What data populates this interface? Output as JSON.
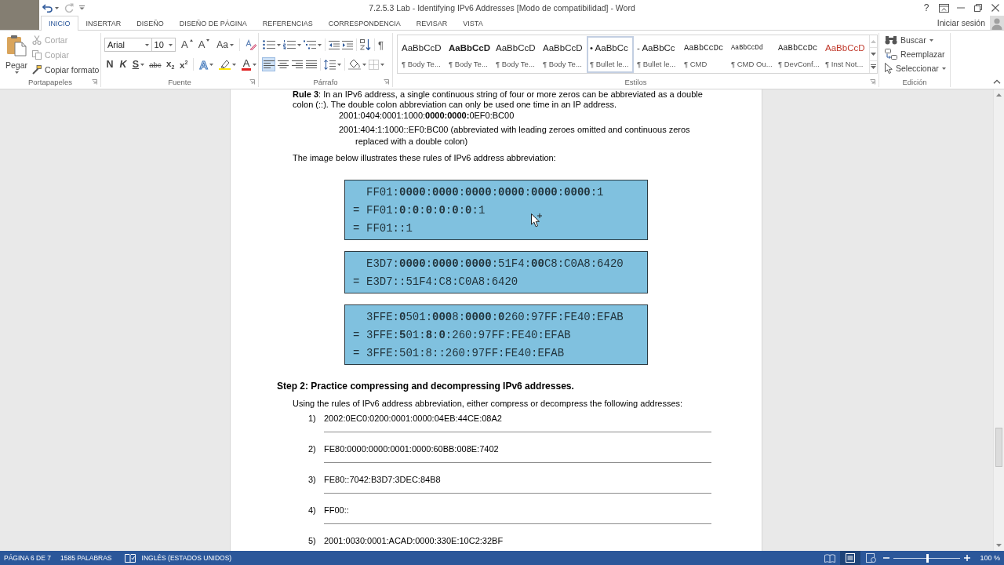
{
  "title_bar": {
    "title": "7.2.5.3 Lab - Identifying IPv6 Addresses [Modo de compatibilidad] - Word",
    "help": "?"
  },
  "tabs": [
    {
      "label": "INICIO",
      "selected": true
    },
    {
      "label": "INSERTAR",
      "selected": false
    },
    {
      "label": "DISEÑO",
      "selected": false
    },
    {
      "label": "DISEÑO DE PÁGINA",
      "selected": false
    },
    {
      "label": "REFERENCIAS",
      "selected": false
    },
    {
      "label": "CORRESPONDENCIA",
      "selected": false
    },
    {
      "label": "REVISAR",
      "selected": false
    },
    {
      "label": "VISTA",
      "selected": false
    }
  ],
  "account": {
    "label": "Iniciar sesión"
  },
  "ribbon": {
    "clipboard": {
      "label": "Portapapeles",
      "paste": "Pegar",
      "actions": [
        {
          "kind": "cut",
          "label": "Cortar",
          "disabled": true
        },
        {
          "kind": "copy",
          "label": "Copiar",
          "disabled": true
        },
        {
          "kind": "format",
          "label": "Copiar formato",
          "disabled": false
        }
      ]
    },
    "font": {
      "label": "Fuente",
      "font_name": "Arial",
      "font_size": "10",
      "size_buttons": [
        {
          "kind": "grow",
          "label": "A"
        },
        {
          "kind": "shrink",
          "label": "A"
        }
      ],
      "case_label": "Aa",
      "format_buttons": [
        {
          "kind": "bold",
          "label": "N",
          "menu": false
        },
        {
          "kind": "italic",
          "label": "K",
          "menu": false
        },
        {
          "kind": "underline",
          "label": "S",
          "menu": true
        },
        {
          "kind": "strike",
          "label": "abc",
          "menu": false
        },
        {
          "kind": "sub",
          "label": "x$_{2}$",
          "menu": false
        },
        {
          "kind": "sup",
          "label": "x$^{2}$",
          "menu": false
        }
      ],
      "effects_label": "A",
      "color_label": "A"
    },
    "paragraph": {
      "label": "Párrafo",
      "marks": "¶",
      "alignments": [
        {
          "kind": "left",
          "selected": true
        },
        {
          "kind": "center",
          "selected": false
        },
        {
          "kind": "right",
          "selected": false
        },
        {
          "kind": "justify",
          "selected": false
        }
      ]
    },
    "styles": {
      "label": "Estilos",
      "items": [
        {
          "preview": "AaBbCcD",
          "name": "¶ Body Te...",
          "kind": "plain",
          "selected": false
        },
        {
          "preview": "AaBbCcD",
          "name": "¶ Body Te...",
          "kind": "strong",
          "selected": false
        },
        {
          "preview": "AaBbCcD",
          "name": "¶ Body Te...",
          "kind": "plain",
          "selected": false
        },
        {
          "preview": "AaBbCcD",
          "name": "¶ Body Te...",
          "kind": "plain",
          "selected": false
        },
        {
          "preview": "• AaBbCc",
          "name": "¶ Bullet le...",
          "kind": "plain",
          "selected": true
        },
        {
          "preview": "- AaBbCc",
          "name": "¶ Bullet le...",
          "kind": "plain",
          "selected": false
        },
        {
          "preview": "AaBbCcDc",
          "name": "¶ CMD",
          "kind": "code",
          "selected": false
        },
        {
          "preview": "AaBbCcDd",
          "name": "¶ CMD Ou...",
          "kind": "output",
          "selected": false
        },
        {
          "preview": "AaBbCcDc",
          "name": "¶ DevConf...",
          "kind": "code",
          "selected": false
        },
        {
          "preview": "AaBbCcD",
          "name": "¶ Inst Not...",
          "kind": "note",
          "selected": false
        }
      ]
    },
    "editing": {
      "label": "Edición",
      "actions": [
        {
          "kind": "find",
          "label": "Buscar",
          "menu": true
        },
        {
          "kind": "replace",
          "label": "Reemplazar",
          "menu": false
        },
        {
          "kind": "select",
          "label": "Seleccionar",
          "menu": true
        }
      ]
    }
  },
  "document": {
    "rule": "**Rule 3**: In an IPv6 address, a single continuous string of four or more zeros can be abbreviated as a double colon (::). The double colon abbreviation can only be used one time in an IP address.",
    "examples": [
      "2001:0404:0001:1000:**0000:0000:**0EF0:BC00",
      "2001:404:1:1000::EF0:BC00 (abbreviated with leading zeroes omitted and continuous zeros replaced with a double colon)"
    ],
    "intro": "The image below illustrates these rules of IPv6 address abbreviation:",
    "figure": [
      {
        "lines": [
          {
            "text": "FF01:**0000**:**0000**:**0000**:**0000**:**0000**:**0000**:1"
          },
          {
            "lead": "=",
            "text": "FF01:**0**:**0**:**0**:**0**:**0**:**0**:1"
          },
          {
            "lead": "=",
            "text": "FF01::1"
          }
        ]
      },
      {
        "lines": [
          {
            "text": "E3D7:**0000**:**0000**:**0000**:51F4:**00**C8:C0A8:6420"
          },
          {
            "lead": "=",
            "text": "E3D7::51F4:C8:C0A8:6420"
          }
        ]
      },
      {
        "lines": [
          {
            "text": "3FFE:**0**501:**000**8:**0000**:**0**260:97FF:FE40:EFAB"
          },
          {
            "lead": "=",
            "text": "3FFE:**5**01:**8**:**0**:260:97FF:FE40:EFAB"
          },
          {
            "lead": "=",
            "text": "3FFE:501:8::260:97FF:FE40:EFAB"
          }
        ]
      }
    ],
    "step": {
      "heading": "Step 2: Practice compressing and decompressing IPv6 addresses.",
      "instruction": "Using the rules of IPv6 address abbreviation, either compress or decompress the following addresses:",
      "items": [
        {
          "number": "1)",
          "address": "2002:0EC0:0200:0001:0000:04EB:44CE:08A2",
          "answer_line": true
        },
        {
          "number": "2)",
          "address": "FE80:0000:0000:0001:0000:60BB:008E:7402",
          "answer_line": true
        },
        {
          "number": "3)",
          "address": "FE80::7042:B3D7:3DEC:84B8",
          "answer_line": true
        },
        {
          "number": "4)",
          "address": "FF00::",
          "answer_line": true
        },
        {
          "number": "5)",
          "address": "2001:0030:0001:ACAD:0000:330E:10C2:32BF",
          "answer_line": false
        }
      ]
    }
  },
  "status_bar": {
    "page": "PÁGINA 6 DE 7",
    "words": "1585 PALABRAS",
    "language": "INGLÉS (ESTADOS UNIDOS)",
    "views": [
      {
        "kind": "read",
        "selected": false
      },
      {
        "kind": "print",
        "selected": true
      },
      {
        "kind": "web",
        "selected": false
      }
    ],
    "zoom": {
      "level": 0.5,
      "reading": "100 %"
    }
  }
}
